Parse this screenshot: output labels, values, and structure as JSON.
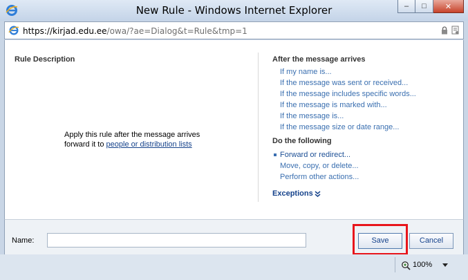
{
  "window": {
    "title": "New Rule - Windows Internet Explorer",
    "minimize_glyph": "–",
    "maximize_glyph": "□",
    "close_glyph": "✕"
  },
  "address": {
    "host": "https://kirjad.edu.ee",
    "path": "/owa/?ae=Dialog&t=Rule&tmp=1"
  },
  "rule_description": {
    "title": "Rule Description",
    "line1": "Apply this rule after the message arrives",
    "line2_prefix": "forward it to ",
    "line2_link": "people or distribution lists"
  },
  "conditions": {
    "title": "After the message arrives",
    "items": [
      "If my name is...",
      "If the message was sent or received...",
      "If the message includes specific words...",
      "If the message is marked with...",
      "If the message is...",
      "If the message size or date range..."
    ]
  },
  "actions": {
    "title": "Do the following",
    "items": [
      "Forward or redirect...",
      "Move, copy, or delete...",
      "Perform other actions..."
    ]
  },
  "exceptions": {
    "label": "Exceptions"
  },
  "footer": {
    "name_label": "Name:",
    "name_value": "",
    "save_label": "Save",
    "cancel_label": "Cancel"
  },
  "status": {
    "zoom": "100%"
  },
  "colors": {
    "highlight": "#e8151b",
    "link": "#3a6fb0"
  },
  "icons": {
    "browser": "ie-icon",
    "lock": "lock-icon",
    "cert": "cert-icon",
    "zoom": "magnifier-icon",
    "exceptions": "double-chevron-down-icon"
  }
}
